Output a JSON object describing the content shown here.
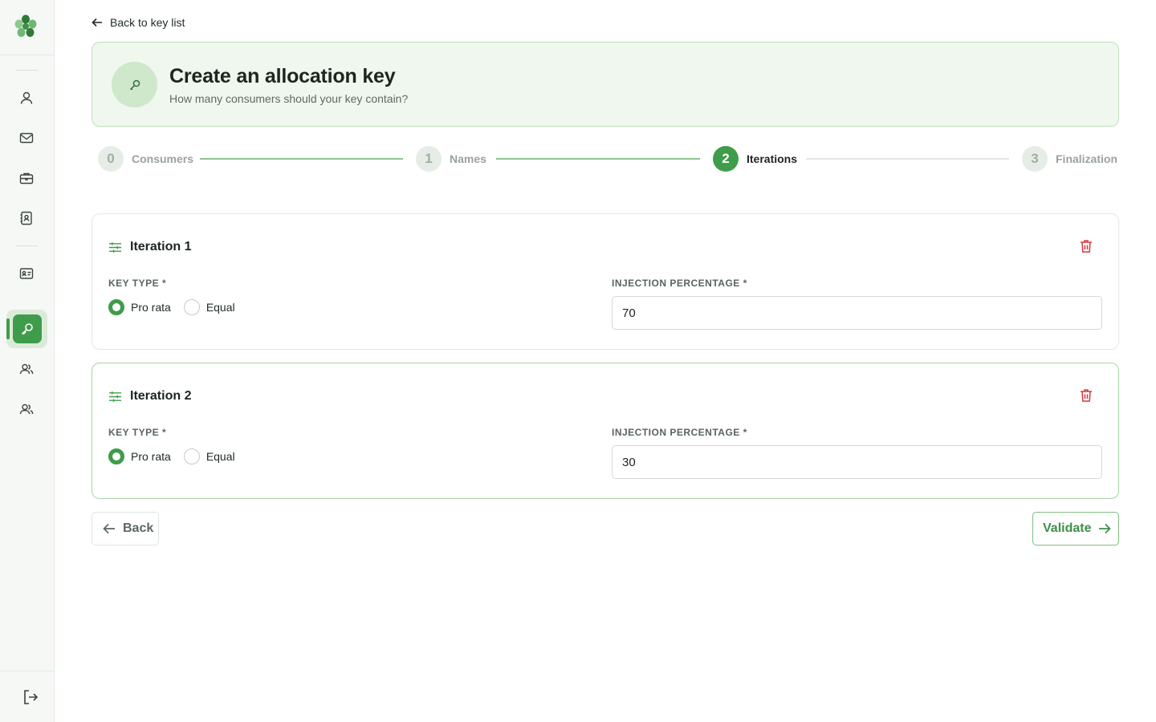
{
  "nav": {
    "back_link": "Back to key list"
  },
  "header": {
    "title": "Create an allocation key",
    "subtitle": "How many consumers should your key contain?"
  },
  "stepper": {
    "steps": [
      {
        "number": "0",
        "label": "Consumers",
        "state": "done"
      },
      {
        "number": "1",
        "label": "Names",
        "state": "done"
      },
      {
        "number": "2",
        "label": "Iterations",
        "state": "active"
      },
      {
        "number": "3",
        "label": "Finalization",
        "state": "todo"
      }
    ]
  },
  "iterations": [
    {
      "title": "Iteration 1",
      "key_type_label": "KEY TYPE *",
      "options": [
        "Pro rata",
        "Equal"
      ],
      "selected": "Pro rata",
      "percentage_label": "INJECTION PERCENTAGE *",
      "percentage_value": "70"
    },
    {
      "title": "Iteration 2",
      "key_type_label": "KEY TYPE *",
      "options": [
        "Pro rata",
        "Equal"
      ],
      "selected": "Pro rata",
      "percentage_label": "INJECTION PERCENTAGE *",
      "percentage_value": "30"
    }
  ],
  "actions": {
    "back_label": "Back",
    "validate_label": "Validate"
  },
  "colors": {
    "accent": "#3f9c4a",
    "danger": "#d9363e",
    "header_bg": "#eff7ee"
  },
  "sidebar_icons": [
    "user-icon",
    "mail-icon",
    "briefcase-icon",
    "contact-book-icon",
    "id-card-icon",
    "key-icon",
    "users-icon",
    "group-icon",
    "logout-icon"
  ]
}
